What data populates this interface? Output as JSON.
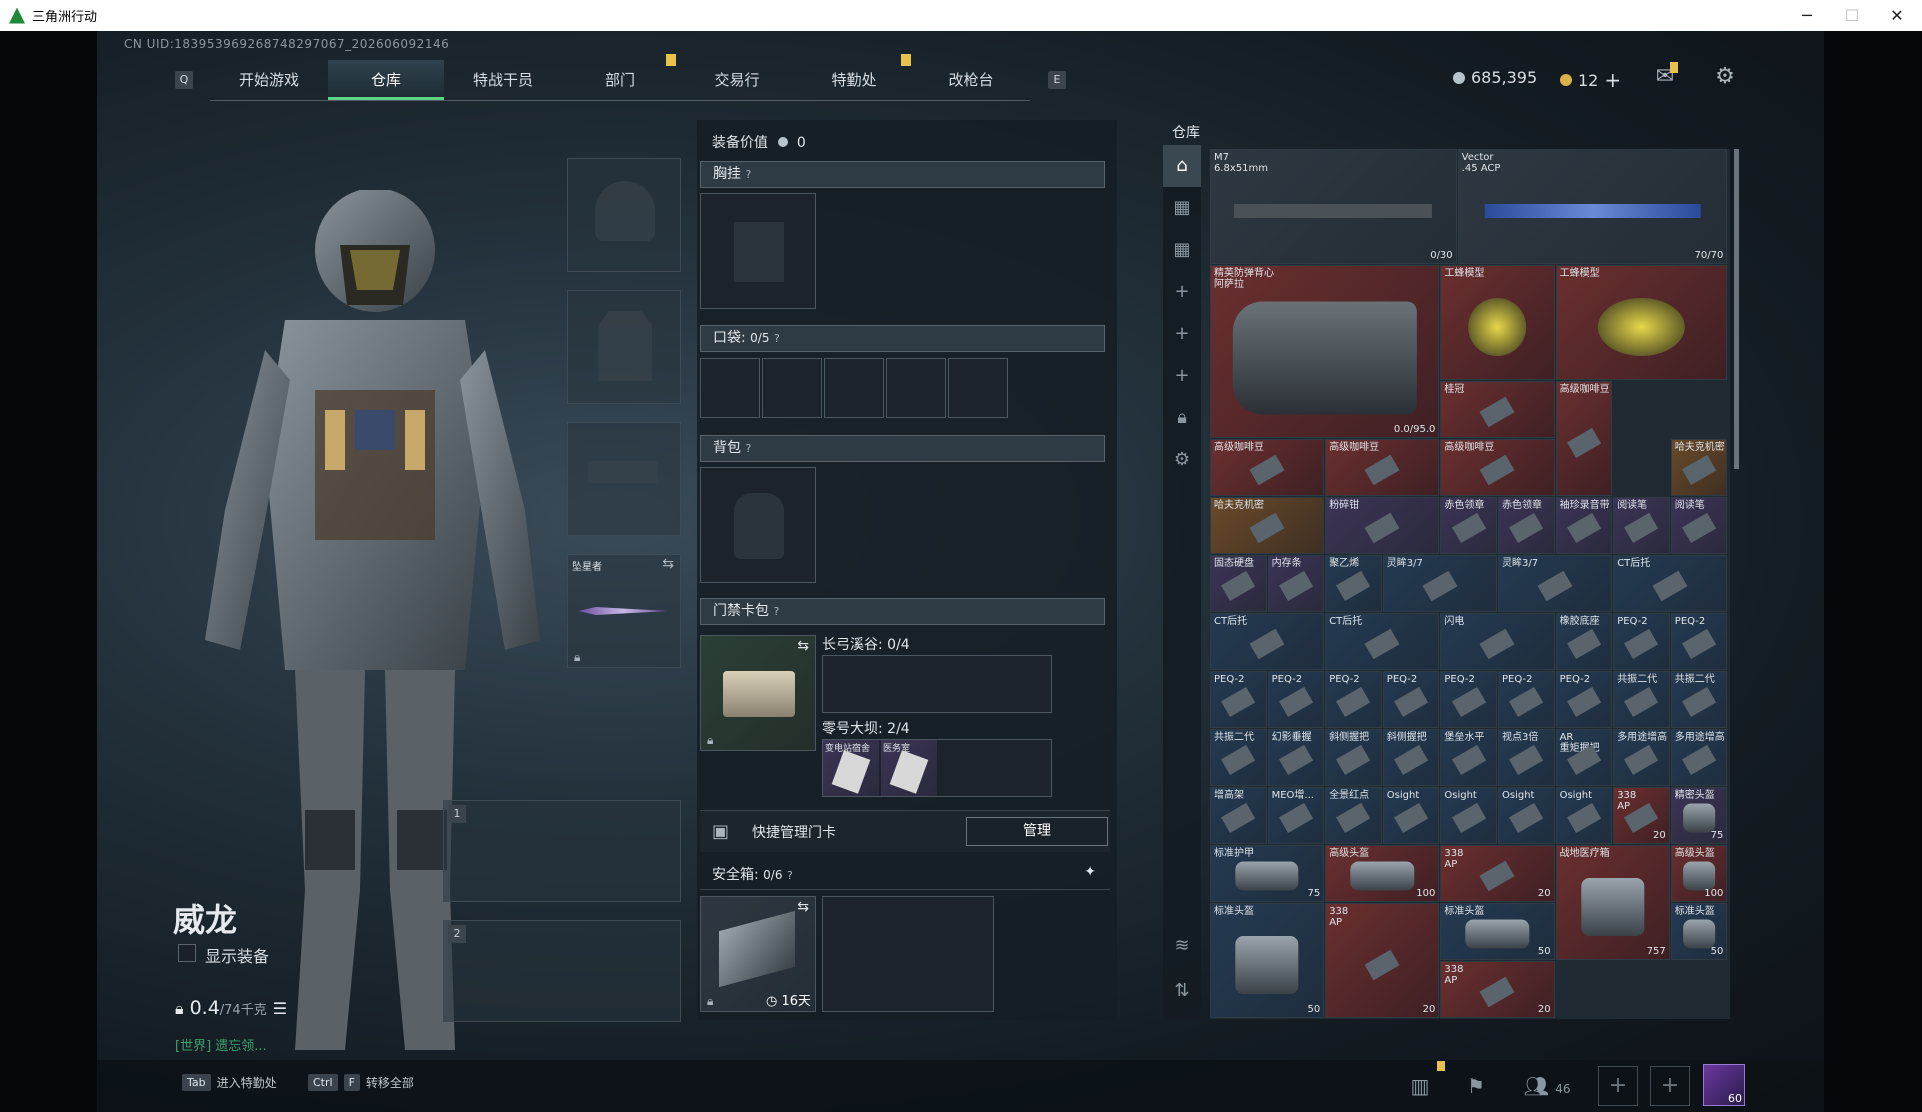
{
  "window": {
    "title": "三角洲行动"
  },
  "header": {
    "uid": "CN UID:183953969268748297067_202606092146",
    "key_left": "Q",
    "key_right": "E",
    "tabs": [
      {
        "label": "开始游戏"
      },
      {
        "label": "仓库"
      },
      {
        "label": "特战干员"
      },
      {
        "label": "部门"
      },
      {
        "label": "交易行"
      },
      {
        "label": "特勤处"
      },
      {
        "label": "改枪台"
      }
    ],
    "active_tab": "仓库",
    "currency": {
      "silver": "685,395",
      "gold": "12"
    }
  },
  "character": {
    "name": "威龙",
    "show_gear_label": "显示装备",
    "weight": "0.4",
    "weight_cap": "/74千克",
    "world_text": "[世界] 遗忘领..."
  },
  "gear_slots": {
    "melee_label": "坠星者",
    "weapon_slot_1": "1",
    "weapon_slot_2": "2"
  },
  "equipment": {
    "value_label": "装备价值",
    "value": "0",
    "chest_rig": "胸挂",
    "pocket_label": "口袋:",
    "pocket_value": "0/5",
    "backpack": "背包",
    "keycard_pack": "门禁卡包",
    "map1_label": "长弓溪谷: 0/4",
    "map2_label": "零号大坝: 2/4",
    "map2_card1": "变电站宿舍",
    "map2_card2": "医务室",
    "quick_manage": "快捷管理门卡",
    "manage_btn": "管理",
    "safebox_label": "安全箱:",
    "safebox_value": "0/6",
    "safebox_days": "16天"
  },
  "inventory": {
    "title": "仓库",
    "items": [
      {
        "name": "M7\n6.8x51mm",
        "qty": "0/30",
        "rarity": "gray"
      },
      {
        "name": "Vector\n.45 ACP",
        "qty": "70/70",
        "rarity": "gray"
      },
      {
        "name": "精英防弹背心\n阿萨拉",
        "qty": "0.0/95.0",
        "rarity": "red"
      },
      {
        "name": "工蜂模型",
        "qty": "",
        "rarity": "red"
      },
      {
        "name": "工蜂模型",
        "qty": "",
        "rarity": "red"
      },
      {
        "name": "桂冠",
        "qty": "",
        "rarity": "red"
      },
      {
        "name": "高级咖啡豆",
        "qty": "",
        "rarity": "red"
      },
      {
        "name": "高级咖啡豆",
        "qty": "",
        "rarity": "red"
      },
      {
        "name": "高级咖啡豆",
        "qty": "",
        "rarity": "red"
      },
      {
        "name": "高级咖啡豆",
        "qty": "",
        "rarity": "red"
      },
      {
        "name": "哈夫克机密",
        "qty": "",
        "rarity": "gold"
      },
      {
        "name": "哈夫克机密",
        "qty": "",
        "rarity": "gold"
      },
      {
        "name": "粉碎钳",
        "qty": "",
        "rarity": "purp"
      },
      {
        "name": "赤色领章",
        "qty": "",
        "rarity": "purp"
      },
      {
        "name": "赤色领章",
        "qty": "",
        "rarity": "purp"
      },
      {
        "name": "袖珍录音带",
        "qty": "",
        "rarity": "purp"
      },
      {
        "name": "阅读笔",
        "qty": "",
        "rarity": "purp"
      },
      {
        "name": "阅读笔",
        "qty": "",
        "rarity": "purp"
      },
      {
        "name": "固态硬盘",
        "qty": "",
        "rarity": "purp"
      },
      {
        "name": "内存条",
        "qty": "",
        "rarity": "purp"
      },
      {
        "name": "聚乙烯",
        "qty": "",
        "rarity": "blue"
      },
      {
        "name": "灵眸3/7",
        "qty": "",
        "rarity": "blue"
      },
      {
        "name": "灵眸3/7",
        "qty": "",
        "rarity": "blue"
      },
      {
        "name": "CT后托",
        "qty": "",
        "rarity": "blue"
      },
      {
        "name": "CT后托",
        "qty": "",
        "rarity": "blue"
      },
      {
        "name": "CT后托",
        "qty": "",
        "rarity": "blue"
      },
      {
        "name": "闪电",
        "qty": "",
        "rarity": "blue"
      },
      {
        "name": "橡胶底座",
        "qty": "",
        "rarity": "blue"
      },
      {
        "name": "PEQ-2",
        "qty": "",
        "rarity": "blue"
      },
      {
        "name": "PEQ-2",
        "qty": "",
        "rarity": "blue"
      },
      {
        "name": "PEQ-2",
        "qty": "",
        "rarity": "blue"
      },
      {
        "name": "PEQ-2",
        "qty": "",
        "rarity": "blue"
      },
      {
        "name": "PEQ-2",
        "qty": "",
        "rarity": "blue"
      },
      {
        "name": "PEQ-2",
        "qty": "",
        "rarity": "blue"
      },
      {
        "name": "PEQ-2",
        "qty": "",
        "rarity": "blue"
      },
      {
        "name": "PEQ-2",
        "qty": "",
        "rarity": "blue"
      },
      {
        "name": "PEQ-2",
        "qty": "",
        "rarity": "blue"
      },
      {
        "name": "共振二代",
        "qty": "",
        "rarity": "blue"
      },
      {
        "name": "共振二代",
        "qty": "",
        "rarity": "blue"
      },
      {
        "name": "共振二代",
        "qty": "",
        "rarity": "blue"
      },
      {
        "name": "幻影垂握",
        "qty": "",
        "rarity": "blue"
      },
      {
        "name": "斜侧握把",
        "qty": "",
        "rarity": "blue"
      },
      {
        "name": "斜侧握把",
        "qty": "",
        "rarity": "blue"
      },
      {
        "name": "堡垒水平",
        "qty": "",
        "rarity": "blue"
      },
      {
        "name": "视点3倍",
        "qty": "",
        "rarity": "blue"
      },
      {
        "name": "AR\n重矩握把",
        "qty": "",
        "rarity": "blue"
      },
      {
        "name": "多用途增高",
        "qty": "",
        "rarity": "blue"
      },
      {
        "name": "多用途增高",
        "qty": "",
        "rarity": "blue"
      },
      {
        "name": "增高架",
        "qty": "",
        "rarity": "blue"
      },
      {
        "name": "MEO增...",
        "qty": "",
        "rarity": "blue"
      },
      {
        "name": "全景红点",
        "qty": "",
        "rarity": "blue"
      },
      {
        "name": "Osight",
        "qty": "",
        "rarity": "blue"
      },
      {
        "name": "Osight",
        "qty": "",
        "rarity": "blue"
      },
      {
        "name": "Osight",
        "qty": "",
        "rarity": "blue"
      },
      {
        "name": "Osight",
        "qty": "",
        "rarity": "blue"
      },
      {
        "name": "338\nAP",
        "qty": "20",
        "rarity": "red"
      },
      {
        "name": "精密头盔",
        "qty": "75",
        "rarity": "purp"
      },
      {
        "name": "标准护甲",
        "qty": "75",
        "rarity": "blue"
      },
      {
        "name": "高级头盔",
        "qty": "100",
        "rarity": "red"
      },
      {
        "name": "338\nAP",
        "qty": "20",
        "rarity": "red"
      },
      {
        "name": "高级头盔",
        "qty": "100",
        "rarity": "red"
      },
      {
        "name": "战地医疗箱",
        "qty": "757",
        "rarity": "red"
      },
      {
        "name": "标准头盔",
        "qty": "50",
        "rarity": "blue"
      },
      {
        "name": "338\nAP",
        "qty": "20",
        "rarity": "red"
      },
      {
        "name": "标准头盔",
        "qty": "50",
        "rarity": "blue"
      },
      {
        "name": "标准头盔",
        "qty": "50",
        "rarity": "blue"
      },
      {
        "name": "338\nAP",
        "qty": "20",
        "rarity": "red"
      }
    ]
  },
  "bottom": {
    "hint1_key": "Tab",
    "hint1_label": "进入特勤处",
    "hint2_key1": "Ctrl",
    "hint2_key2": "F",
    "hint2_label": "转移全部",
    "friends_count": "46",
    "avatar_level": "60"
  }
}
